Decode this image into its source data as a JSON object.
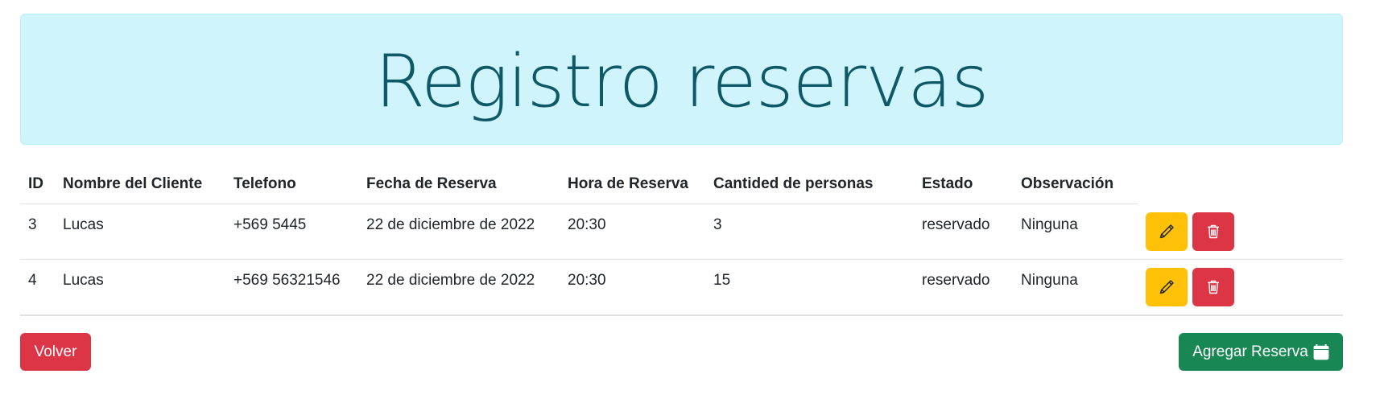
{
  "header": {
    "title": "Registro reservas"
  },
  "table": {
    "columns": [
      "ID",
      "Nombre del Cliente",
      "Telefono",
      "Fecha de Reserva",
      "Hora de Reserva",
      "Cantided de personas",
      "Estado",
      "Observación"
    ],
    "rows": [
      {
        "id": "3",
        "nombre": "Lucas",
        "telefono": "+569 5445",
        "fecha": "22 de diciembre de 2022",
        "hora": "20:30",
        "cantidad": "3",
        "estado": "reservado",
        "observacion": "Ninguna"
      },
      {
        "id": "4",
        "nombre": "Lucas",
        "telefono": "+569 56321546",
        "fecha": "22 de diciembre de 2022",
        "hora": "20:30",
        "cantidad": "15",
        "estado": "reservado",
        "observacion": "Ninguna"
      }
    ],
    "row_actions": {
      "edit_icon": "pencil-icon",
      "delete_icon": "trash-icon"
    }
  },
  "footer": {
    "back_label": "Volver",
    "add_label": "Agregar Reserva",
    "add_icon": "calendar-icon"
  },
  "colors": {
    "banner_bg": "#cff4fc",
    "banner_text": "#055160",
    "warning": "#ffc107",
    "danger": "#dc3545",
    "success": "#198754"
  }
}
